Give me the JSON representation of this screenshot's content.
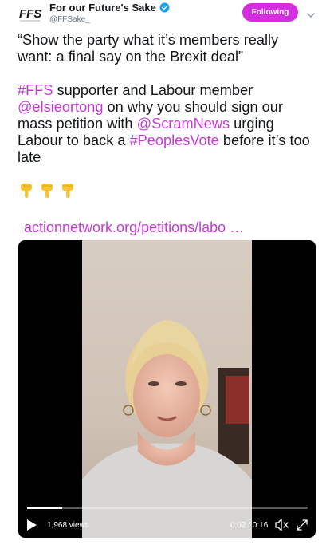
{
  "account": {
    "display_name": "For our Future's Sake",
    "handle": "@FFSake_",
    "avatar_text": "FFS",
    "verified": true
  },
  "follow_label": "Following",
  "tweet": {
    "line1": "“Show the party what it’s members really want: a final say on the Brexit deal”",
    "hashtag_ffs": "#FFS",
    "text_a": " supporter and Labour member ",
    "mention_elsie": "@elsieortong",
    "text_b": " on why you should sign our mass petition with ",
    "mention_scram": "@ScramNews",
    "text_c": " urging Labour to back a ",
    "hashtag_pv": "#PeoplesVote",
    "text_d": " before it’s too late"
  },
  "emojis": [
    "pointing-down-hand",
    "pointing-down-hand",
    "pointing-down-hand"
  ],
  "link": "actionnetwork.org/petitions/labo …",
  "video": {
    "views": "1,968 views",
    "time": "0:02 / 0:16",
    "progress": 0.125
  },
  "colors": {
    "accent": "#c73ad6",
    "follow_bg": "#d52ee0",
    "verified": "#1da1f2",
    "text": "#14171a",
    "muted": "#657786"
  }
}
